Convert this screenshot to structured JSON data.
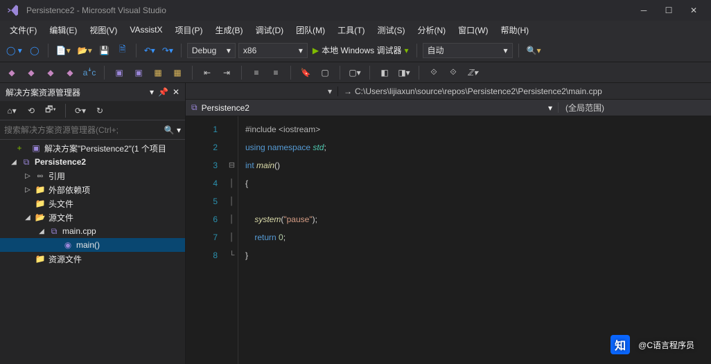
{
  "title": "Persistence2 - Microsoft Visual Studio",
  "menus": [
    "文件(F)",
    "编辑(E)",
    "视图(V)",
    "VAssistX",
    "项目(P)",
    "生成(B)",
    "调试(D)",
    "团队(M)",
    "工具(T)",
    "测试(S)",
    "分析(N)",
    "窗口(W)",
    "帮助(H)"
  ],
  "config": "Debug",
  "platform": "x86",
  "debug_target": "本地 Windows 调试器",
  "auto": "自动",
  "panel": {
    "title": "解决方案资源管理器",
    "search_placeholder": "搜索解决方案资源管理器(Ctrl+;"
  },
  "tree": {
    "solution": "解决方案\"Persistence2\"(1 个项目",
    "project": "Persistence2",
    "refs": "引用",
    "external": "外部依赖项",
    "headers": "头文件",
    "sources": "源文件",
    "main_cpp": "main.cpp",
    "main_fn": "main()",
    "resources": "资源文件"
  },
  "crumbs": {
    "path": "C:\\Users\\lijiaxun\\source\\repos\\Persistence2\\Persistence2\\main.cpp",
    "scope_project": "Persistence2",
    "scope_global": "(全局范围)"
  },
  "code": {
    "l1": {
      "a": "#include",
      "b": "<iostream>"
    },
    "l2": {
      "a": "using",
      "b": "namespace",
      "c": "std"
    },
    "l3": {
      "a": "int",
      "b": "main",
      "c": "()"
    },
    "l4": "{",
    "l6": {
      "a": "system",
      "b": "(",
      "c": "\"pause\"",
      "d": ");"
    },
    "l7": {
      "a": "return",
      "b": "0",
      "c": ";"
    },
    "l8": "}"
  },
  "watermark": "@C语言程序员"
}
